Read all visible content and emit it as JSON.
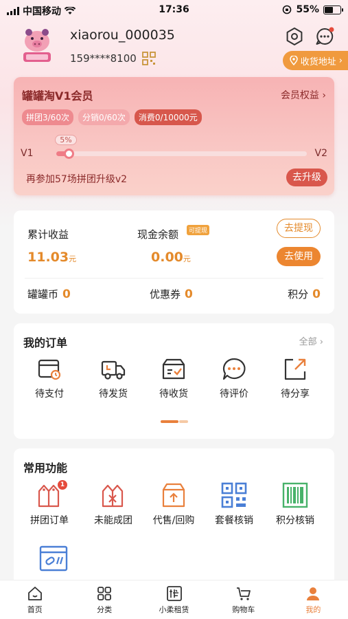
{
  "status_bar": {
    "carrier": "中国移动",
    "time": "17:36",
    "battery": "55%",
    "battery_level": 0.55
  },
  "profile": {
    "username": "xiaorou_000035",
    "phone": "159****8100",
    "address_button": "收货地址"
  },
  "member_card": {
    "title": "罐罐淘V1会员",
    "rights_link": "会员权益",
    "chips": [
      "拼团3/60次",
      "分销0/60次",
      "消费0/10000元"
    ],
    "level_from": "V1",
    "level_to": "V2",
    "progress_label": "5%",
    "progress": 0.05,
    "upgrade_hint": "再参加57场拼团升级v2",
    "upgrade_button": "去升级"
  },
  "earnings": {
    "total_label": "累计收益",
    "total_value": "11.03",
    "cash_label": "现金余额",
    "cash_tag": "可提现",
    "cash_value": "0.00",
    "unit": "元",
    "withdraw_button": "去提现",
    "use_button": "去使用",
    "coins_label": "罐罐币",
    "coins_value": "0",
    "coupons_label": "优惠券",
    "coupons_value": "0",
    "points_label": "积分",
    "points_value": "0"
  },
  "orders": {
    "title": "我的订单",
    "see_all": "全部",
    "items": [
      {
        "label": "待支付",
        "icon": "wallet-clock-icon"
      },
      {
        "label": "待发货",
        "icon": "truck-icon"
      },
      {
        "label": "待收货",
        "icon": "box-check-icon"
      },
      {
        "label": "待评价",
        "icon": "chat-bubble-icon"
      },
      {
        "label": "待分享",
        "icon": "share-arrow-icon"
      }
    ]
  },
  "tools": {
    "title": "常用功能",
    "items": [
      {
        "label": "拼团订单",
        "icon": "group-tags-icon",
        "badge": "1"
      },
      {
        "label": "未能成团",
        "icon": "failed-group-icon"
      },
      {
        "label": "代售/回购",
        "icon": "resale-box-icon"
      },
      {
        "label": "套餐核销",
        "icon": "qr-code-icon"
      },
      {
        "label": "积分核销",
        "icon": "barcode-icon"
      },
      {
        "label": "",
        "icon": "link-card-icon"
      }
    ]
  },
  "tabbar": {
    "items": [
      {
        "label": "首页",
        "icon": "home-icon"
      },
      {
        "label": "分类",
        "icon": "grid-icon"
      },
      {
        "label": "小柔租赁",
        "icon": "rent-icon"
      },
      {
        "label": "购物车",
        "icon": "cart-icon"
      },
      {
        "label": "我的",
        "icon": "user-icon"
      }
    ],
    "active": "我的"
  },
  "colors": {
    "accent": "#e9803c",
    "member_text": "#8b2a2a",
    "member_button": "#d9574c",
    "blue_icon": "#4a7fd6",
    "green_icon": "#48b26a"
  }
}
